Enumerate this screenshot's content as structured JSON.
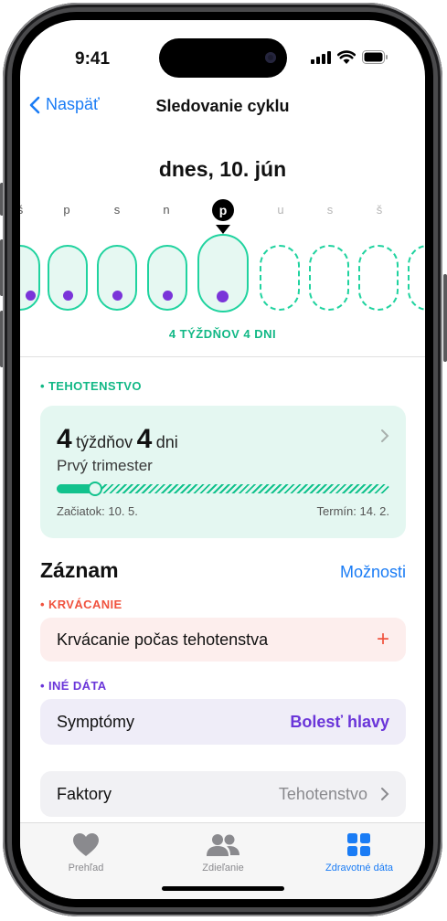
{
  "status_bar": {
    "time": "9:41"
  },
  "nav": {
    "back_label": "Naspäť",
    "title": "Sledovanie cyklu"
  },
  "date_title": "dnes, 10. jún",
  "week": {
    "days": [
      "š",
      "p",
      "s",
      "n",
      "p",
      "u",
      "s",
      "š"
    ],
    "today_index": 4,
    "label": "4 TÝŽDŇOV 4 DNI"
  },
  "pregnancy": {
    "section_label": "TEHOTENSTVO",
    "weeks_value": "4",
    "weeks_unit": "týždňov",
    "days_value": "4",
    "days_unit": "dni",
    "trimester": "Prvý trimester",
    "progress_fraction": 0.11,
    "start_label": "Začiatok: 10. 5.",
    "due_label": "Termín: 14. 2."
  },
  "log": {
    "title": "Záznam",
    "options_label": "Možnosti",
    "bleeding_label": "KRVÁCANIE",
    "bleeding_row": "Krvácanie počas tehotenstva",
    "add_icon": "+",
    "other_label": "INÉ DÁTA",
    "symptoms_label": "Symptómy",
    "symptoms_value": "Bolesť hlavy",
    "factors_label": "Faktory",
    "factors_value": "Tehotenstvo"
  },
  "tabs": [
    {
      "label": "Prehľad",
      "icon": "heart-icon",
      "active": false
    },
    {
      "label": "Zdieľanie",
      "icon": "people-icon",
      "active": false
    },
    {
      "label": "Zdravotné dáta",
      "icon": "grid-icon",
      "active": true
    }
  ],
  "colors": {
    "accent_blue": "#1a7cf5",
    "pregnancy_green": "#12b886",
    "bleeding_red": "#f0533f",
    "other_purple": "#6a35d9"
  }
}
